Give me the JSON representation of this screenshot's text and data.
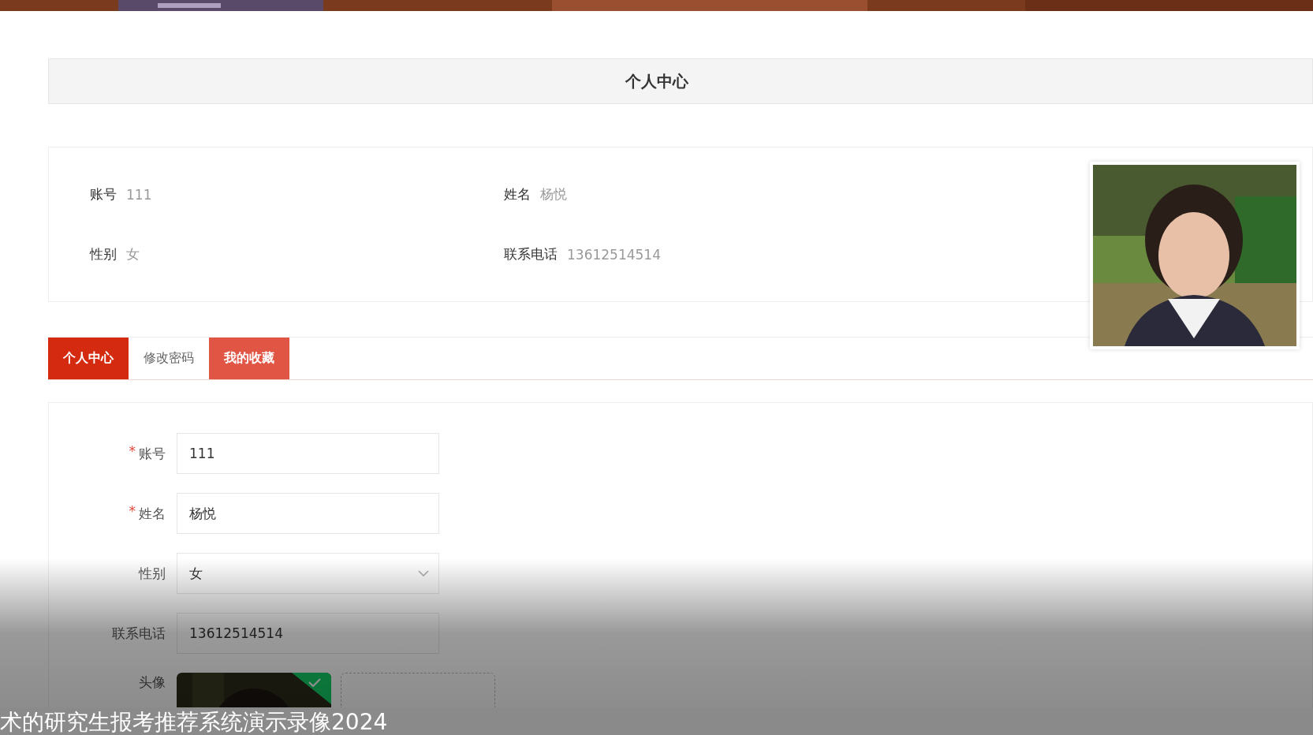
{
  "header": {
    "title": "个人中心"
  },
  "profile": {
    "fields": [
      {
        "label": "账号",
        "value": "111"
      },
      {
        "label": "姓名",
        "value": "杨悦"
      },
      {
        "label": "性别",
        "value": "女"
      },
      {
        "label": "联系电话",
        "value": "13612514514"
      }
    ]
  },
  "tabs": [
    {
      "label": "个人中心",
      "selected": true,
      "hovered": false
    },
    {
      "label": "修改密码",
      "selected": false,
      "hovered": false
    },
    {
      "label": "我的收藏",
      "selected": false,
      "hovered": true
    }
  ],
  "form": {
    "fields": [
      {
        "kind": "input",
        "marker": "*",
        "label": "账号",
        "value": "111"
      },
      {
        "kind": "input",
        "marker": "*",
        "label": "姓名",
        "value": "杨悦"
      },
      {
        "kind": "select",
        "label": "性别",
        "value": "女"
      },
      {
        "kind": "input",
        "label": "联系电话",
        "value": "13612514514"
      },
      {
        "kind": "upload",
        "label": "头像",
        "uploaded": true
      }
    ]
  },
  "caption": "术的研究生报考推荐系统演示录像2024"
}
